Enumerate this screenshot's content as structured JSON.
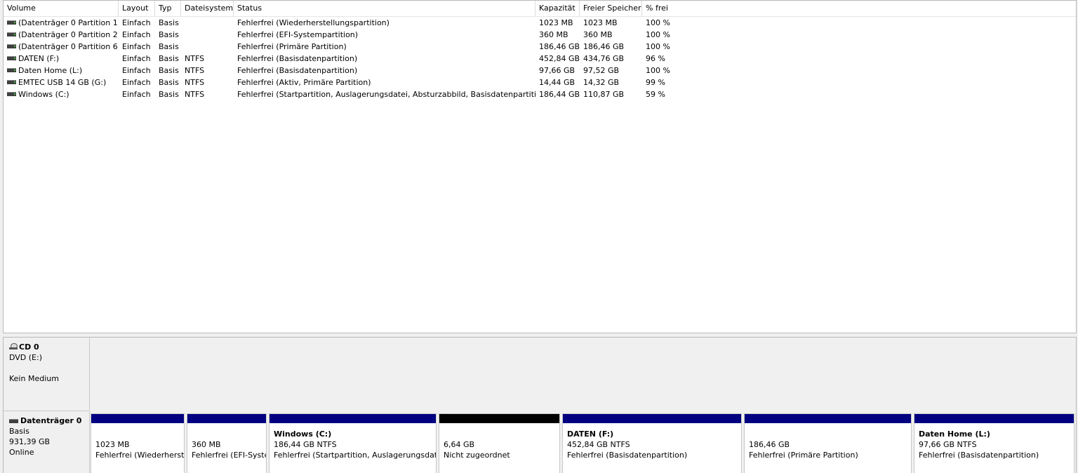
{
  "columns": [
    "Volume",
    "Layout",
    "Typ",
    "Dateisystem",
    "Status",
    "Kapazität",
    "Freier Speicher",
    "% frei"
  ],
  "volumes": [
    {
      "volume": "(Datenträger 0 Partition 1)",
      "layout": "Einfach",
      "typ": "Basis",
      "fs": "",
      "status": "Fehlerfrei (Wiederherstellungspartition)",
      "capacity": "1023 MB",
      "free": "1023 MB",
      "pct": "100 %"
    },
    {
      "volume": "(Datenträger 0 Partition 2)",
      "layout": "Einfach",
      "typ": "Basis",
      "fs": "",
      "status": "Fehlerfrei (EFI-Systempartition)",
      "capacity": "360 MB",
      "free": "360 MB",
      "pct": "100 %"
    },
    {
      "volume": "(Datenträger 0 Partition 6)",
      "layout": "Einfach",
      "typ": "Basis",
      "fs": "",
      "status": "Fehlerfrei (Primäre Partition)",
      "capacity": "186,46 GB",
      "free": "186,46 GB",
      "pct": "100 %"
    },
    {
      "volume": "DATEN (F:)",
      "layout": "Einfach",
      "typ": "Basis",
      "fs": "NTFS",
      "status": "Fehlerfrei (Basisdatenpartition)",
      "capacity": "452,84 GB",
      "free": "434,76 GB",
      "pct": "96 %"
    },
    {
      "volume": "Daten Home (L:)",
      "layout": "Einfach",
      "typ": "Basis",
      "fs": "NTFS",
      "status": "Fehlerfrei (Basisdatenpartition)",
      "capacity": "97,66 GB",
      "free": "97,52 GB",
      "pct": "100 %"
    },
    {
      "volume": "EMTEC USB 14 GB (G:)",
      "layout": "Einfach",
      "typ": "Basis",
      "fs": "NTFS",
      "status": "Fehlerfrei (Aktiv, Primäre Partition)",
      "capacity": "14,44 GB",
      "free": "14,32 GB",
      "pct": "99 %"
    },
    {
      "volume": "Windows (C:)",
      "layout": "Einfach",
      "typ": "Basis",
      "fs": "NTFS",
      "status": "Fehlerfrei (Startpartition, Auslagerungsdatei, Absturzabbild, Basisdatenpartition)",
      "capacity": "186,44 GB",
      "free": "110,87 GB",
      "pct": "59 %"
    }
  ],
  "cd": {
    "title": "CD 0",
    "type": "DVD (E:)",
    "status": "Kein Medium"
  },
  "disk0": {
    "title": "Datenträger 0",
    "type": "Basis",
    "size": "931,39 GB",
    "status": "Online",
    "partitions": [
      {
        "name": "",
        "size": "1023 MB",
        "status": "Fehlerfrei (Wiederherstellungspartition)",
        "unallocated": false
      },
      {
        "name": "",
        "size": "360 MB",
        "status": "Fehlerfrei (EFI-Systempartition)",
        "unallocated": false
      },
      {
        "name": "Windows  (C:)",
        "size": "186,44 GB NTFS",
        "status": "Fehlerfrei (Startpartition, Auslagerungsdatei, Absturzabbild, Basisdatenpartition)",
        "unallocated": false
      },
      {
        "name": "",
        "size": "6,64 GB",
        "status": "Nicht zugeordnet",
        "unallocated": true
      },
      {
        "name": "DATEN  (F:)",
        "size": "452,84 GB NTFS",
        "status": "Fehlerfrei (Basisdatenpartition)",
        "unallocated": false
      },
      {
        "name": "",
        "size": "186,46 GB",
        "status": "Fehlerfrei (Primäre Partition)",
        "unallocated": false
      },
      {
        "name": "Daten Home  (L:)",
        "size": "97,66 GB NTFS",
        "status": "Fehlerfrei (Basisdatenpartition)",
        "unallocated": false
      }
    ]
  }
}
